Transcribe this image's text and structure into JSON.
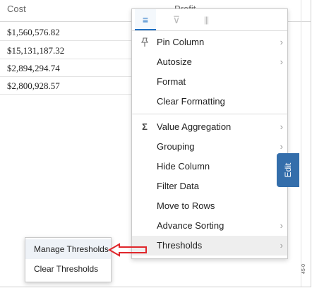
{
  "grid": {
    "headers": [
      "Cost",
      "Profit"
    ],
    "rows": [
      {
        "cost": "$1,560,576.82"
      },
      {
        "cost": "$15,131,187.32"
      },
      {
        "cost": "$2,894,294.74"
      },
      {
        "cost": "$2,800,928.57"
      }
    ]
  },
  "column_menu": {
    "tabs": [
      {
        "icon": "menu-icon",
        "glyph": "≡"
      },
      {
        "icon": "filter-icon",
        "glyph": "⊽"
      },
      {
        "icon": "columns-icon",
        "glyph": "|||"
      }
    ],
    "items": [
      {
        "label": "Pin Column",
        "icon": "pin-icon",
        "glyph": "📌",
        "has_submenu": true
      },
      {
        "label": "Autosize",
        "has_submenu": true
      },
      {
        "label": "Format",
        "has_submenu": false
      },
      {
        "label": "Clear Formatting",
        "has_submenu": false
      },
      {
        "label": "Value Aggregation",
        "icon": "sigma-icon",
        "glyph": "Σ",
        "has_submenu": true
      },
      {
        "label": "Grouping",
        "has_submenu": true
      },
      {
        "label": "Hide Column",
        "has_submenu": false
      },
      {
        "label": "Filter Data",
        "has_submenu": false
      },
      {
        "label": "Move to Rows",
        "has_submenu": false
      },
      {
        "label": "Advance Sorting",
        "has_submenu": true
      },
      {
        "label": "Thresholds",
        "has_submenu": true,
        "active": true
      }
    ],
    "chevron": "›"
  },
  "thresholds_submenu": {
    "items": [
      {
        "label": "Manage Thresholds"
      },
      {
        "label": "Clear Thresholds"
      }
    ]
  },
  "edit_tab": {
    "label": "Edit"
  },
  "side_note": {
    "text": "45-0"
  },
  "colors": {
    "accent": "#1e6fc3",
    "edit_tab": "#346eab",
    "annotation_arrow": "#e0262b"
  }
}
